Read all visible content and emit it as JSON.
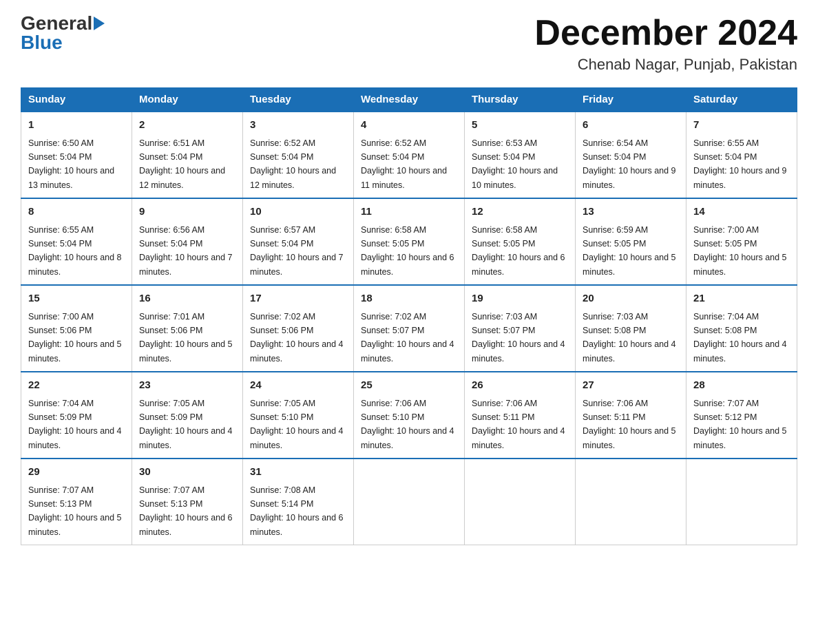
{
  "header": {
    "logo": {
      "general": "General",
      "blue": "Blue"
    },
    "month_title": "December 2024",
    "subtitle": "Chenab Nagar, Punjab, Pakistan"
  },
  "days_of_week": [
    "Sunday",
    "Monday",
    "Tuesday",
    "Wednesday",
    "Thursday",
    "Friday",
    "Saturday"
  ],
  "weeks": [
    [
      {
        "day": "1",
        "sunrise": "6:50 AM",
        "sunset": "5:04 PM",
        "daylight": "10 hours and 13 minutes."
      },
      {
        "day": "2",
        "sunrise": "6:51 AM",
        "sunset": "5:04 PM",
        "daylight": "10 hours and 12 minutes."
      },
      {
        "day": "3",
        "sunrise": "6:52 AM",
        "sunset": "5:04 PM",
        "daylight": "10 hours and 12 minutes."
      },
      {
        "day": "4",
        "sunrise": "6:52 AM",
        "sunset": "5:04 PM",
        "daylight": "10 hours and 11 minutes."
      },
      {
        "day": "5",
        "sunrise": "6:53 AM",
        "sunset": "5:04 PM",
        "daylight": "10 hours and 10 minutes."
      },
      {
        "day": "6",
        "sunrise": "6:54 AM",
        "sunset": "5:04 PM",
        "daylight": "10 hours and 9 minutes."
      },
      {
        "day": "7",
        "sunrise": "6:55 AM",
        "sunset": "5:04 PM",
        "daylight": "10 hours and 9 minutes."
      }
    ],
    [
      {
        "day": "8",
        "sunrise": "6:55 AM",
        "sunset": "5:04 PM",
        "daylight": "10 hours and 8 minutes."
      },
      {
        "day": "9",
        "sunrise": "6:56 AM",
        "sunset": "5:04 PM",
        "daylight": "10 hours and 7 minutes."
      },
      {
        "day": "10",
        "sunrise": "6:57 AM",
        "sunset": "5:04 PM",
        "daylight": "10 hours and 7 minutes."
      },
      {
        "day": "11",
        "sunrise": "6:58 AM",
        "sunset": "5:05 PM",
        "daylight": "10 hours and 6 minutes."
      },
      {
        "day": "12",
        "sunrise": "6:58 AM",
        "sunset": "5:05 PM",
        "daylight": "10 hours and 6 minutes."
      },
      {
        "day": "13",
        "sunrise": "6:59 AM",
        "sunset": "5:05 PM",
        "daylight": "10 hours and 5 minutes."
      },
      {
        "day": "14",
        "sunrise": "7:00 AM",
        "sunset": "5:05 PM",
        "daylight": "10 hours and 5 minutes."
      }
    ],
    [
      {
        "day": "15",
        "sunrise": "7:00 AM",
        "sunset": "5:06 PM",
        "daylight": "10 hours and 5 minutes."
      },
      {
        "day": "16",
        "sunrise": "7:01 AM",
        "sunset": "5:06 PM",
        "daylight": "10 hours and 5 minutes."
      },
      {
        "day": "17",
        "sunrise": "7:02 AM",
        "sunset": "5:06 PM",
        "daylight": "10 hours and 4 minutes."
      },
      {
        "day": "18",
        "sunrise": "7:02 AM",
        "sunset": "5:07 PM",
        "daylight": "10 hours and 4 minutes."
      },
      {
        "day": "19",
        "sunrise": "7:03 AM",
        "sunset": "5:07 PM",
        "daylight": "10 hours and 4 minutes."
      },
      {
        "day": "20",
        "sunrise": "7:03 AM",
        "sunset": "5:08 PM",
        "daylight": "10 hours and 4 minutes."
      },
      {
        "day": "21",
        "sunrise": "7:04 AM",
        "sunset": "5:08 PM",
        "daylight": "10 hours and 4 minutes."
      }
    ],
    [
      {
        "day": "22",
        "sunrise": "7:04 AM",
        "sunset": "5:09 PM",
        "daylight": "10 hours and 4 minutes."
      },
      {
        "day": "23",
        "sunrise": "7:05 AM",
        "sunset": "5:09 PM",
        "daylight": "10 hours and 4 minutes."
      },
      {
        "day": "24",
        "sunrise": "7:05 AM",
        "sunset": "5:10 PM",
        "daylight": "10 hours and 4 minutes."
      },
      {
        "day": "25",
        "sunrise": "7:06 AM",
        "sunset": "5:10 PM",
        "daylight": "10 hours and 4 minutes."
      },
      {
        "day": "26",
        "sunrise": "7:06 AM",
        "sunset": "5:11 PM",
        "daylight": "10 hours and 4 minutes."
      },
      {
        "day": "27",
        "sunrise": "7:06 AM",
        "sunset": "5:11 PM",
        "daylight": "10 hours and 5 minutes."
      },
      {
        "day": "28",
        "sunrise": "7:07 AM",
        "sunset": "5:12 PM",
        "daylight": "10 hours and 5 minutes."
      }
    ],
    [
      {
        "day": "29",
        "sunrise": "7:07 AM",
        "sunset": "5:13 PM",
        "daylight": "10 hours and 5 minutes."
      },
      {
        "day": "30",
        "sunrise": "7:07 AM",
        "sunset": "5:13 PM",
        "daylight": "10 hours and 6 minutes."
      },
      {
        "day": "31",
        "sunrise": "7:08 AM",
        "sunset": "5:14 PM",
        "daylight": "10 hours and 6 minutes."
      },
      null,
      null,
      null,
      null
    ]
  ]
}
